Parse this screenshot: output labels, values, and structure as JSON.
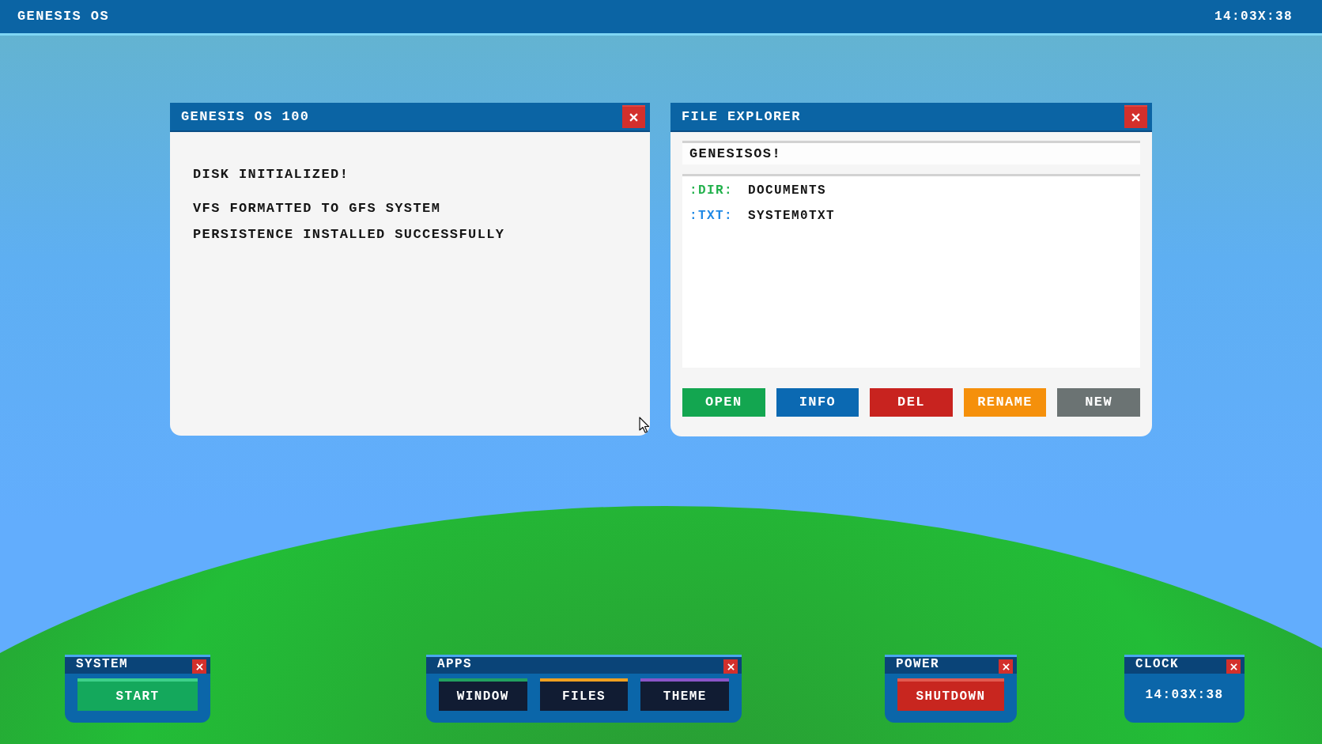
{
  "top_bar": {
    "title": "GENESIS OS",
    "clock": "14:03X:38"
  },
  "windows": [
    {
      "kind": "log",
      "title": "GENESIS OS 100",
      "lines": [
        "DISK INITIALIZED!",
        "VFS FORMATTED TO GFS SYSTEM",
        "PERSISTENCE INSTALLED SUCCESSFULLY"
      ]
    },
    {
      "kind": "explorer",
      "title": "FILE EXPLORER",
      "path": "GENESISOS!",
      "entries": [
        {
          "label": ":DIR:",
          "name": "DOCUMENTS",
          "color": "#22b14c"
        },
        {
          "label": ":TXT:",
          "name": "SYSTEM0TXT",
          "color": "#1e88e5"
        }
      ],
      "buttons": [
        {
          "label": "OPEN",
          "color": "#13a650"
        },
        {
          "label": "INFO",
          "color": "#0b69b2"
        },
        {
          "label": "DEL",
          "color": "#c8231f"
        },
        {
          "label": "RENAME",
          "color": "#f5900b"
        },
        {
          "label": "NEW",
          "color": "#6b7373"
        }
      ]
    }
  ],
  "taskbar": [
    {
      "kind": "buttons",
      "title": "SYSTEM",
      "buttons": [
        {
          "label": "START",
          "color": "#14a85c",
          "stripe": {
            "color": "#3ed08a"
          }
        }
      ]
    },
    {
      "kind": "buttons",
      "title": "APPS",
      "buttons": [
        {
          "label": "WINDOW",
          "color": "#111c33",
          "stripe": {
            "color": "#22a060"
          }
        },
        {
          "label": "FILES",
          "color": "#111c33",
          "stripe": {
            "color": "#f0a020"
          }
        },
        {
          "label": "THEME",
          "color": "#111c33",
          "stripe": {
            "color": "#8a55c8"
          }
        }
      ]
    },
    {
      "kind": "buttons",
      "title": "POWER",
      "buttons": [
        {
          "label": "SHUTDOWN",
          "color": "#c8261f",
          "stripe": {
            "color": "#e25a4f"
          }
        }
      ]
    },
    {
      "kind": "clock",
      "title": "CLOCK",
      "time": "14:03X:38"
    }
  ]
}
